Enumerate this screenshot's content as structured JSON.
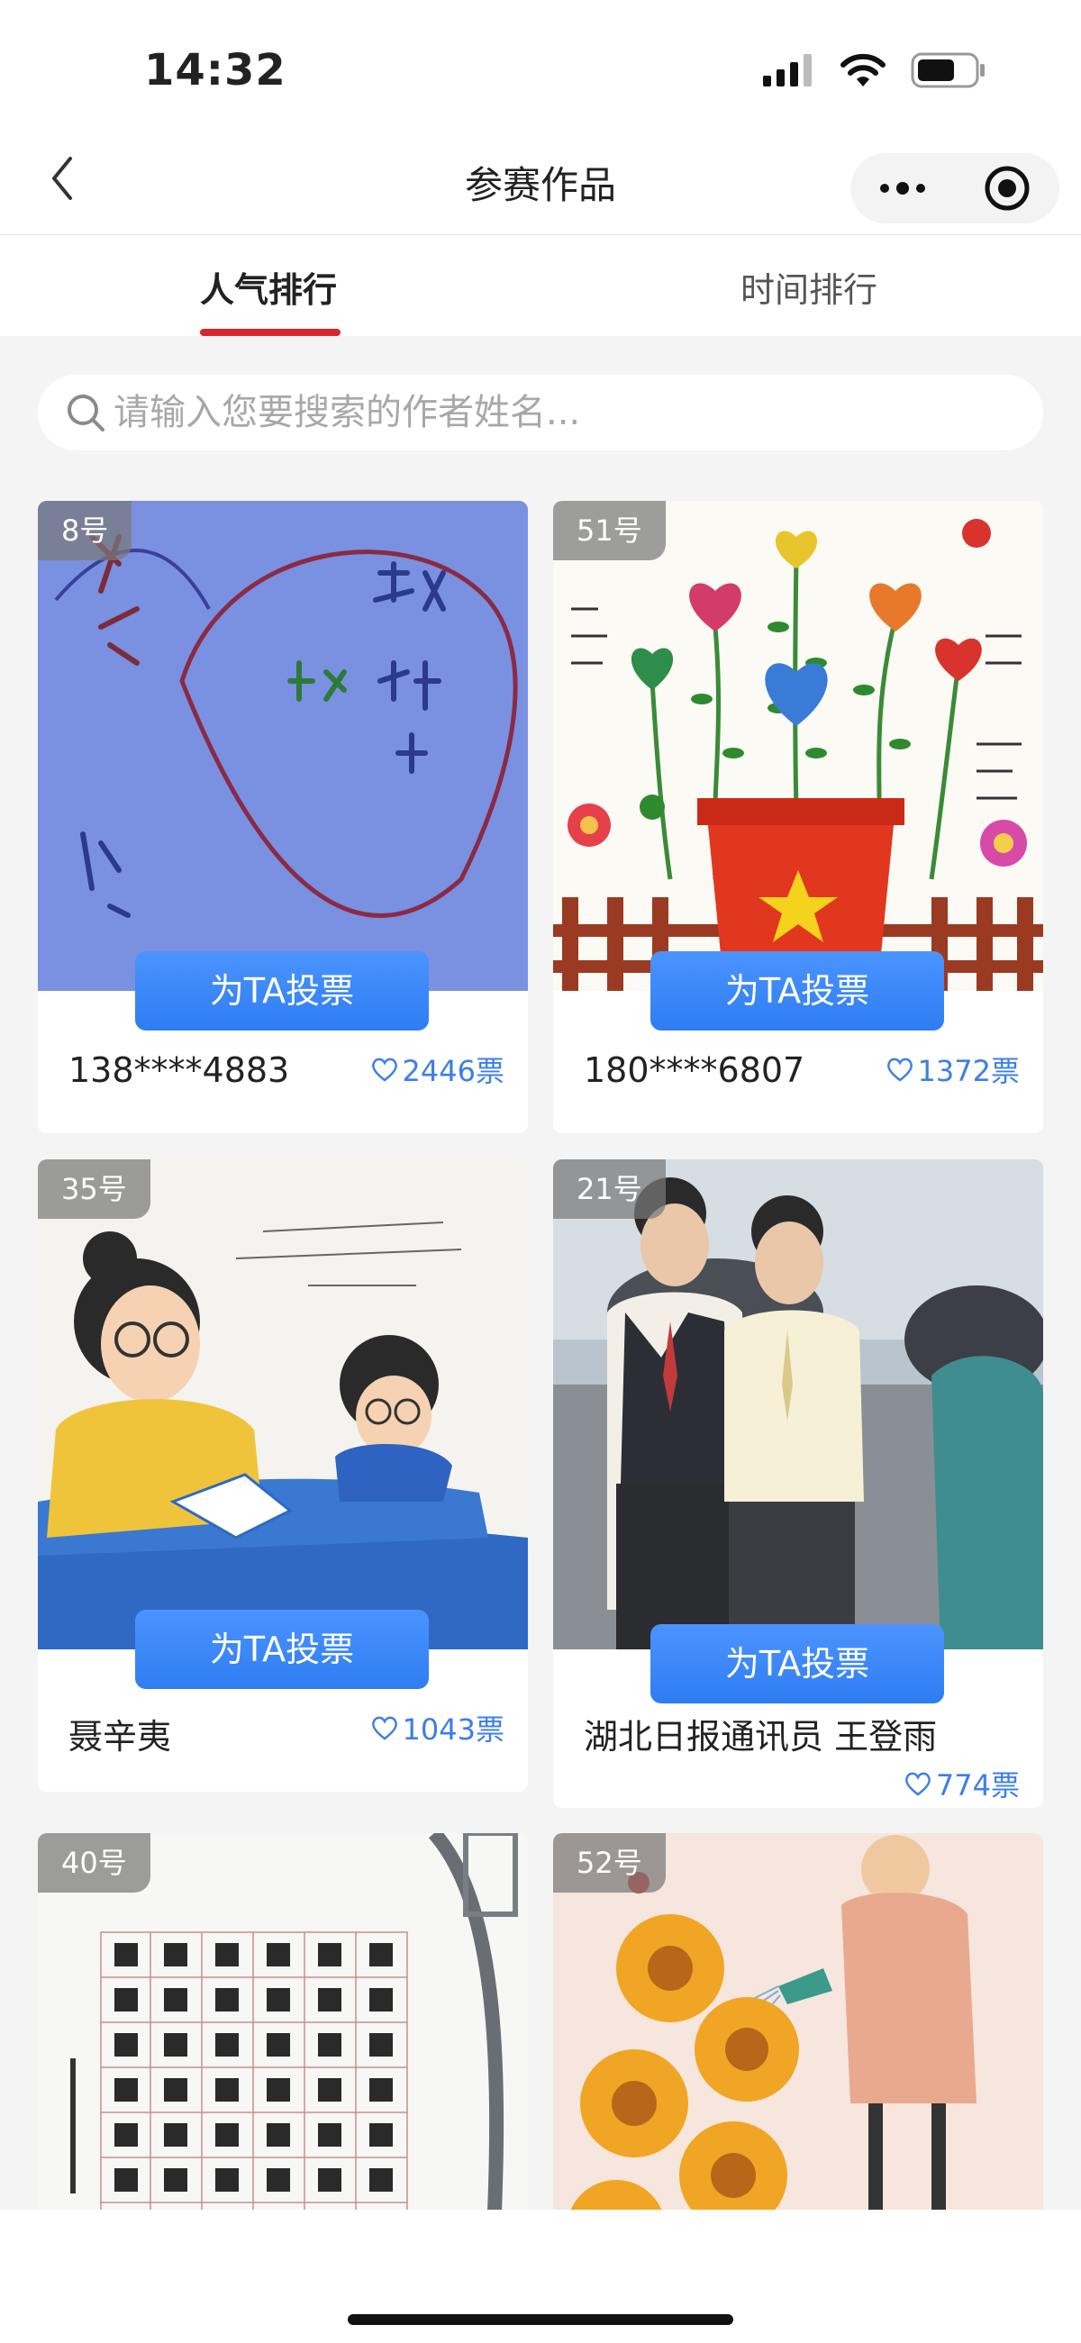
{
  "status_bar": {
    "time": "14:32"
  },
  "nav": {
    "title": "参赛作品"
  },
  "tabs": [
    {
      "label": "人气排行",
      "active": true
    },
    {
      "label": "时间排行",
      "active": false
    }
  ],
  "search": {
    "placeholder": "请输入您要搜索的作者姓名..."
  },
  "vote_button_label": "为TA投票",
  "works": [
    {
      "number": "8号",
      "author": "138****4883",
      "votes": "2446票"
    },
    {
      "number": "51号",
      "author": "180****6807",
      "votes": "1372票"
    },
    {
      "number": "35号",
      "author": "聂辛夷",
      "votes": "1043票"
    },
    {
      "number": "21号",
      "author": "湖北日报通讯员 王登雨",
      "votes": "774票"
    },
    {
      "number": "40号"
    },
    {
      "number": "52号"
    }
  ],
  "colors": {
    "accent": "#d8262f",
    "vote_button": "#3b86f7",
    "votes_text": "#3d7fe6"
  },
  "icons": [
    "back-icon",
    "more-icon",
    "close-capsule-icon",
    "search-icon",
    "heart-icon",
    "signal-icon",
    "wifi-icon",
    "battery-icon"
  ]
}
